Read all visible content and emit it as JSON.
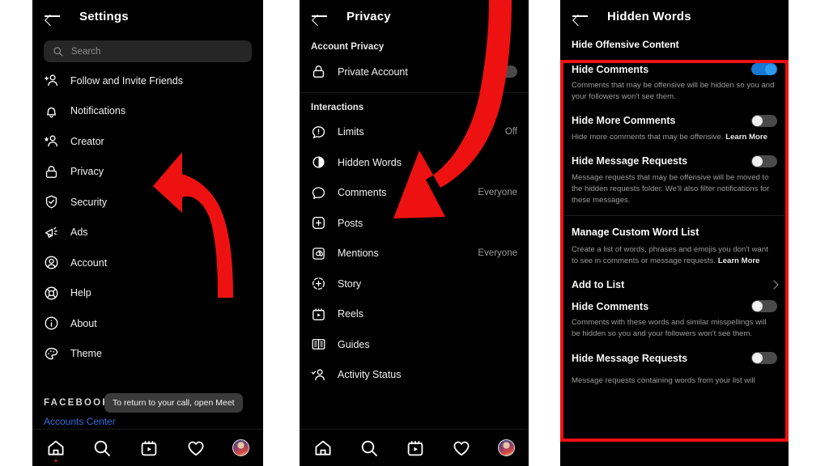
{
  "meta": {
    "accent_blue": "#1878d4",
    "highlight_red": "#ee1111",
    "panel_background": "#000000",
    "page_background": "#ffffff"
  },
  "panel_settings": {
    "title": "Settings",
    "back_icon": "back-arrow-icon",
    "search": {
      "placeholder": "Search",
      "icon": "search-icon"
    },
    "items": [
      {
        "label": "Follow and Invite Friends",
        "icon": "add-person-icon",
        "value": ""
      },
      {
        "label": "Notifications",
        "icon": "bell-icon",
        "value": ""
      },
      {
        "label": "Creator",
        "icon": "star-person-icon",
        "value": ""
      },
      {
        "label": "Privacy",
        "icon": "lock-icon",
        "value": ""
      },
      {
        "label": "Security",
        "icon": "shield-check-icon",
        "value": ""
      },
      {
        "label": "Ads",
        "icon": "megaphone-icon",
        "value": ""
      },
      {
        "label": "Account",
        "icon": "account-circle-icon",
        "value": ""
      },
      {
        "label": "Help",
        "icon": "lifebuoy-icon",
        "value": ""
      },
      {
        "label": "About",
        "icon": "info-circle-icon",
        "value": ""
      },
      {
        "label": "Theme",
        "icon": "palette-icon",
        "value": ""
      }
    ],
    "footer": {
      "brand": "FACEBOOK",
      "accounts_center": "Accounts Center"
    },
    "tooltip": "To return to your call, open Meet",
    "bottom_nav": [
      {
        "name": "home",
        "icon": "home-icon",
        "active": true
      },
      {
        "name": "search",
        "icon": "search-icon",
        "active": false
      },
      {
        "name": "reels",
        "icon": "reels-icon",
        "active": false
      },
      {
        "name": "activity",
        "icon": "heart-icon",
        "active": false
      },
      {
        "name": "profile",
        "icon": "avatar-icon",
        "active": false
      }
    ]
  },
  "panel_privacy": {
    "title": "Privacy",
    "back_icon": "back-arrow-icon",
    "sections": [
      {
        "heading": "Account Privacy",
        "items": [
          {
            "label": "Private Account",
            "icon": "lock-icon",
            "control": "toggle",
            "toggle_on": false,
            "value": ""
          }
        ]
      },
      {
        "heading": "Interactions",
        "items": [
          {
            "label": "Limits",
            "icon": "limits-icon",
            "control": "value",
            "value": "Off"
          },
          {
            "label": "Hidden Words",
            "icon": "hidden-words-icon",
            "control": "value",
            "value": ""
          },
          {
            "label": "Comments",
            "icon": "comment-icon",
            "control": "value",
            "value": "Everyone"
          },
          {
            "label": "Posts",
            "icon": "plus-square-icon",
            "control": "value",
            "value": ""
          },
          {
            "label": "Mentions",
            "icon": "at-icon",
            "control": "value",
            "value": "Everyone"
          },
          {
            "label": "Story",
            "icon": "story-plus-icon",
            "control": "value",
            "value": ""
          },
          {
            "label": "Reels",
            "icon": "reels-icon",
            "control": "value",
            "value": ""
          },
          {
            "label": "Guides",
            "icon": "guides-icon",
            "control": "value",
            "value": ""
          },
          {
            "label": "Activity Status",
            "icon": "activity-status-icon",
            "control": "value",
            "value": ""
          }
        ]
      }
    ],
    "bottom_nav": [
      {
        "name": "home",
        "icon": "home-icon"
      },
      {
        "name": "search",
        "icon": "search-icon"
      },
      {
        "name": "reels",
        "icon": "reels-icon"
      },
      {
        "name": "activity",
        "icon": "heart-icon"
      },
      {
        "name": "profile",
        "icon": "avatar-icon"
      }
    ]
  },
  "panel_hidden_words": {
    "title": "Hidden Words",
    "back_icon": "back-arrow-icon",
    "section_offensive": {
      "heading": "Hide Offensive Content",
      "rows": [
        {
          "label": "Hide Comments",
          "toggle_on": true,
          "description": "Comments that may be offensive will be hidden so you and your followers won't see them.",
          "learn_more": ""
        },
        {
          "label": "Hide More Comments",
          "toggle_on": false,
          "description": "Hide more comments that may be offensive.",
          "learn_more": "Learn More"
        },
        {
          "label": "Hide Message Requests",
          "toggle_on": false,
          "description": "Message requests that may be offensive will be moved to the hidden requests folder. We'll also filter notifications for these messages.",
          "learn_more": ""
        }
      ]
    },
    "section_custom": {
      "heading": "Manage Custom Word List",
      "description": "Create a list of words, phrases and emojis you don't want to see in comments or message requests.",
      "learn_more": "Learn More",
      "add_to_list": "Add to List",
      "rows": [
        {
          "label": "Hide Comments",
          "toggle_on": false,
          "description": "Comments with these words and similar misspellings will be hidden so you and your followers won't see them.",
          "learn_more": ""
        },
        {
          "label": "Hide Message Requests",
          "toggle_on": false,
          "description": "Message requests containing words from your list will",
          "learn_more": ""
        }
      ]
    }
  },
  "annotations": {
    "arrow_settings": "red-curved-arrow-pointing-to-privacy",
    "arrow_privacy": "red-curved-arrow-pointing-to-hidden-words",
    "highlight_box": "red-rectangle-around-hidden-words-settings"
  }
}
